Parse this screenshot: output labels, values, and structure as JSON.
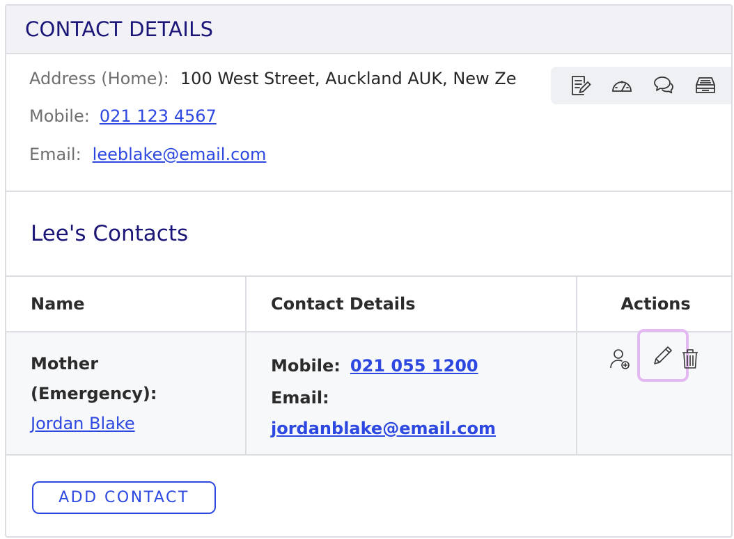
{
  "header": {
    "title": "CONTACT DETAILS"
  },
  "details": {
    "address_label": "Address (Home):",
    "address_value": "100 West Street, Auckland AUK, New Ze",
    "mobile_label": "Mobile:",
    "mobile_value": "021 123 4567",
    "email_label": "Email:",
    "email_value": "leeblake@email.com"
  },
  "toolbar": {
    "icons": [
      "notes-icon",
      "dashboard-gauge-icon",
      "chat-bubbles-icon",
      "inbox-tray-icon"
    ]
  },
  "contacts": {
    "title": "Lee's Contacts",
    "columns": [
      "Name",
      "Contact Details",
      "Actions"
    ],
    "rows": [
      {
        "relation_line1": "Mother",
        "relation_line2": "(Emergency):",
        "name": "Jordan Blake",
        "mobile_label": "Mobile:",
        "mobile": "021 055 1200",
        "email_label": "Email:",
        "email": "jordanblake@email.com",
        "actions": [
          "add-person-icon",
          "edit-pencil-icon",
          "trash-icon"
        ]
      }
    ]
  },
  "add_contact_label": "ADD CONTACT",
  "colors": {
    "accent": "#2c48e0",
    "heading": "#1a1577",
    "highlight": "#e4b8f2"
  }
}
